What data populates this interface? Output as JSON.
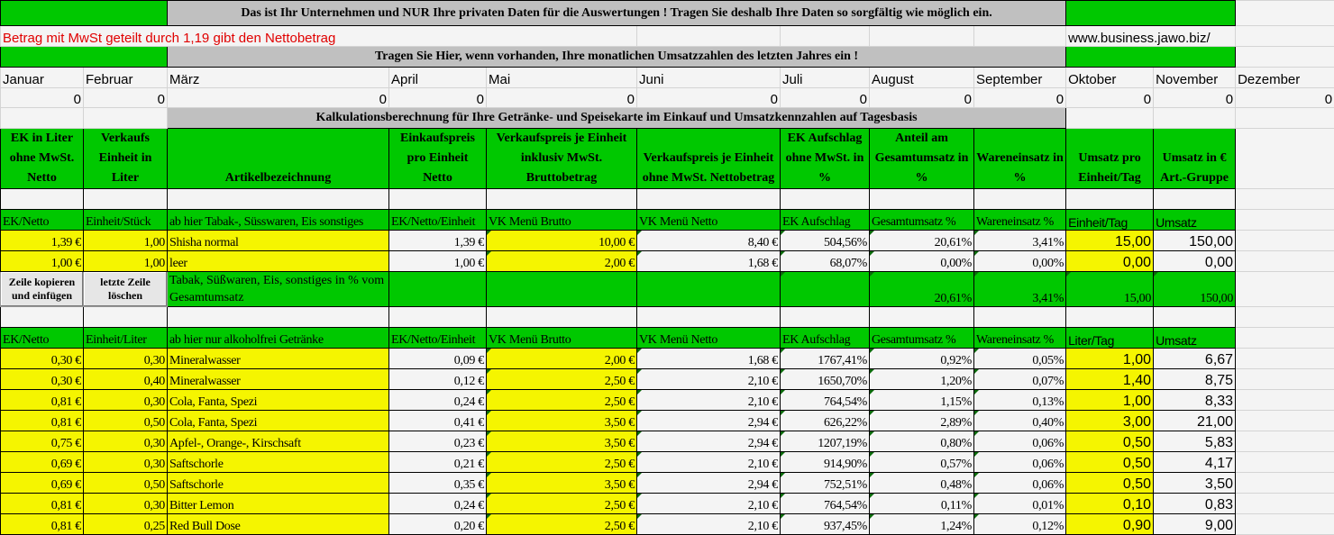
{
  "banner": {
    "privacy_notice": "Das ist Ihr Unternehmen und NUR Ihre privaten Daten für die Auswertungen ! Tragen Sie deshalb Ihre Daten so sorgfältig wie möglich ein.",
    "vat_hint": "Betrag mit MwSt geteilt durch 1,19 gibt den  Nettobetrag",
    "website": "www.business.jawo.biz/",
    "monthly_prompt": "Tragen Sie Hier, wenn vorhanden, Ihre monatlichen Umsatzzahlen des letzten Jahres ein  !",
    "calc_title": "Kalkulationsberechnung für Ihre Getränke- und Speisekarte im Einkauf und Umsatzkennzahlen auf Tagesbasis"
  },
  "months": [
    {
      "name": "Januar",
      "value": "0"
    },
    {
      "name": "Februar",
      "value": "0"
    },
    {
      "name": "März",
      "value": "0"
    },
    {
      "name": "April",
      "value": "0"
    },
    {
      "name": "Mai",
      "value": "0"
    },
    {
      "name": "Juni",
      "value": "0"
    },
    {
      "name": "Juli",
      "value": "0"
    },
    {
      "name": "August",
      "value": "0"
    },
    {
      "name": "September",
      "value": "0"
    },
    {
      "name": "Oktober",
      "value": "0"
    },
    {
      "name": "November",
      "value": "0"
    },
    {
      "name": "Dezember",
      "value": "0"
    }
  ],
  "headers": [
    "EK in Liter ohne MwSt. Netto",
    "Verkaufs Einheit in Liter",
    "Artikelbezeichnung",
    "Einkaufspreis pro Einheit Netto",
    "Verkaufspreis je Einheit inklusiv MwSt. Bruttobetrag",
    "Verkaufspreis je Einheit ohne MwSt. Nettobetrag",
    "EK Aufschlag ohne MwSt. in %",
    "Anteil am Gesamtumsatz in %",
    "Wareneinsatz in %",
    "Umsatz pro Einheit/Tag",
    "Umsatz in € Art.-Gruppe"
  ],
  "section_tobacco": {
    "subheaders": [
      "EK/Netto",
      "Einheit/Stück",
      "ab hier Tabak-, Süsswaren, Eis sonstiges",
      "EK/Netto/Einheit",
      "VK Menü Brutto",
      "VK Menü Netto",
      "EK Aufschlag",
      "Gesamtumsatz %",
      "Wareneinsatz %",
      "Einheit/Tag",
      "Umsatz"
    ],
    "rows": [
      [
        "1,39 €",
        "1,00",
        "Shisha normal",
        "1,39 €",
        "10,00 €",
        "8,40 €",
        "504,56%",
        "20,61%",
        "3,41%",
        "15,00",
        "150,00"
      ],
      [
        "1,00 €",
        "1,00",
        "leer",
        "1,00 €",
        "2,00 €",
        "1,68 €",
        "68,07%",
        "0,00%",
        "0,00%",
        "0,00",
        "0,00"
      ]
    ],
    "summary_label": "Tabak, Süßwaren, Eis, sonstiges in % vom Gesamtumsatz",
    "summary": {
      "share": "20,61%",
      "cost": "3,41%",
      "per_day": "15,00",
      "revenue": "150,00"
    }
  },
  "buttons": {
    "copy_row": "Zeile kopieren und einfügen",
    "delete_row": "letzte Zeile löschen"
  },
  "section_drinks": {
    "subheaders": [
      "EK/Netto",
      "Einheit/Liter",
      "ab hier nur alkoholfrei Getränke",
      "EK/Netto/Einheit",
      "VK Menü Brutto",
      "VK Menü Netto",
      "EK Aufschlag",
      "Gesamtumsatz %",
      "Wareneinsatz %",
      "Liter/Tag",
      "Umsatz"
    ],
    "rows": [
      [
        "0,30 €",
        "0,30",
        "Mineralwasser",
        "0,09 €",
        "2,00 €",
        "1,68 €",
        "1767,41%",
        "0,92%",
        "0,05%",
        "1,00",
        "6,67"
      ],
      [
        "0,30 €",
        "0,40",
        "Mineralwasser",
        "0,12 €",
        "2,50 €",
        "2,10 €",
        "1650,70%",
        "1,20%",
        "0,07%",
        "1,40",
        "8,75"
      ],
      [
        "0,81 €",
        "0,30",
        "Cola, Fanta, Spezi",
        "0,24 €",
        "2,50 €",
        "2,10 €",
        "764,54%",
        "1,15%",
        "0,13%",
        "1,00",
        "8,33"
      ],
      [
        "0,81 €",
        "0,50",
        "Cola, Fanta, Spezi",
        "0,41 €",
        "3,50 €",
        "2,94 €",
        "626,22%",
        "2,89%",
        "0,40%",
        "3,00",
        "21,00"
      ],
      [
        "0,75 €",
        "0,30",
        "Apfel-, Orange-, Kirschsaft",
        "0,23 €",
        "3,50 €",
        "2,94 €",
        "1207,19%",
        "0,80%",
        "0,06%",
        "0,50",
        "5,83"
      ],
      [
        "0,69 €",
        "0,30",
        "Saftschorle",
        "0,21 €",
        "2,50 €",
        "2,10 €",
        "914,90%",
        "0,57%",
        "0,06%",
        "0,50",
        "4,17"
      ],
      [
        "0,69 €",
        "0,50",
        "Saftschorle",
        "0,35 €",
        "3,50 €",
        "2,94 €",
        "752,51%",
        "0,48%",
        "0,06%",
        "0,50",
        "3,50"
      ],
      [
        "0,81 €",
        "0,30",
        "Bitter Lemon",
        "0,24 €",
        "2,50 €",
        "2,10 €",
        "764,54%",
        "0,11%",
        "0,01%",
        "0,10",
        "0,83"
      ],
      [
        "0,81 €",
        "0,25",
        "Red Bull Dose",
        "0,20 €",
        "2,50 €",
        "2,10 €",
        "937,45%",
        "1,24%",
        "0,12%",
        "0,90",
        "9,00"
      ]
    ]
  },
  "colors": {
    "green": "#00c800",
    "yellow": "#f5f500",
    "gray": "#c0c0c0",
    "red_text": "#e00000"
  }
}
